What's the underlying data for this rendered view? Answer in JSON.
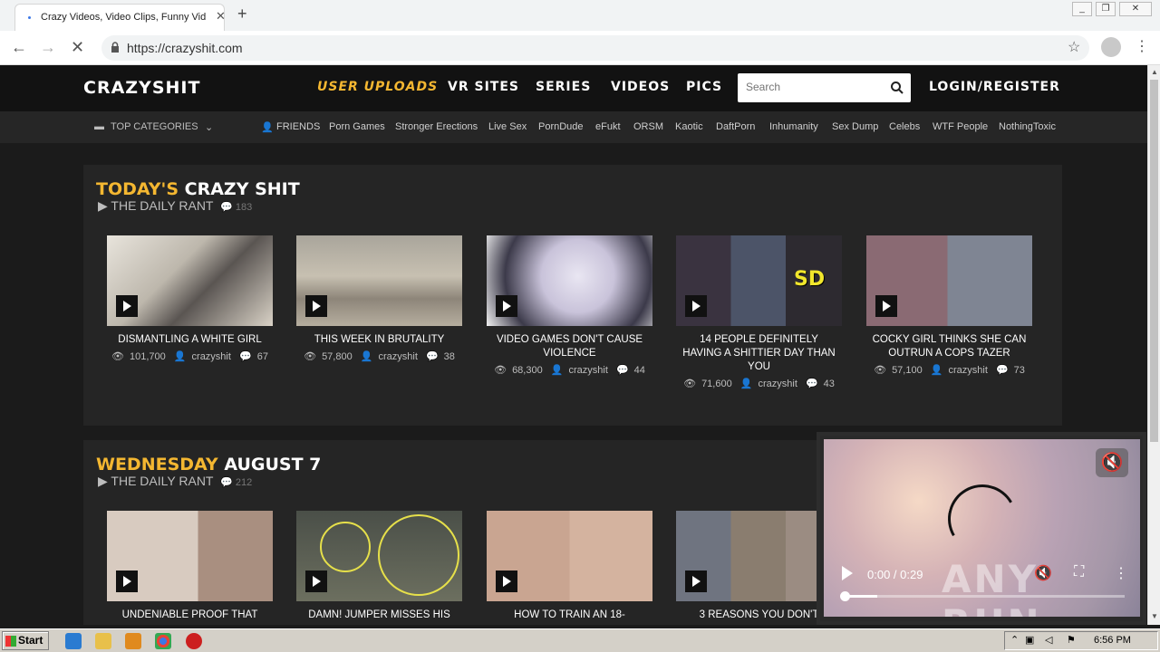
{
  "browser": {
    "tab_title": "Crazy Videos, Video Clips, Funny Vid",
    "tab_close": "✕",
    "new_tab": "+",
    "url": "https://crazyshit.com"
  },
  "site": {
    "logo": "CRAZYSHIT",
    "menu": [
      {
        "label": "USER UPLOADS"
      },
      {
        "label": "VR SITES"
      },
      {
        "label": "SERIES"
      },
      {
        "label": "VIDEOS"
      },
      {
        "label": "PICS"
      }
    ],
    "search_placeholder": "Search",
    "login": "LOGIN/REGISTER",
    "top_categories": "TOP CATEGORIES",
    "friends": "FRIENDS",
    "links": [
      "Porn Games",
      "Stronger Erections",
      "Live Sex",
      "PornDude",
      "eFukt",
      "ORSM",
      "Kaotic",
      "DaftPorn",
      "Inhumanity",
      "Sex Dump",
      "Celebs",
      "WTF People",
      "NothingToxic"
    ]
  },
  "sections": [
    {
      "title_hl": "TODAY'S",
      "title_rest": "CRAZY SHIT",
      "sub": "THE DAILY RANT",
      "sub_count": "183",
      "cards": [
        {
          "title": "DISMANTLING A WHITE GIRL",
          "views": "101,700",
          "user": "crazyshit",
          "comments": "67"
        },
        {
          "title": "THIS WEEK IN BRUTALITY",
          "views": "57,800",
          "user": "crazyshit",
          "comments": "38"
        },
        {
          "title": "VIDEO GAMES DON'T CAUSE VIOLENCE",
          "views": "68,300",
          "user": "crazyshit",
          "comments": "44"
        },
        {
          "title": "14 PEOPLE DEFINITELY HAVING A SHITTIER DAY THAN YOU",
          "views": "71,600",
          "user": "crazyshit",
          "comments": "43"
        },
        {
          "title": "COCKY GIRL THINKS SHE CAN OUTRUN A COPS TAZER",
          "views": "57,100",
          "user": "crazyshit",
          "comments": "73"
        }
      ]
    },
    {
      "title_hl": "WEDNESDAY",
      "title_rest": "AUGUST 7",
      "sub": "THE DAILY RANT",
      "sub_count": "212",
      "cards": [
        {
          "title": "UNDENIABLE PROOF THAT"
        },
        {
          "title": "DAMN! JUMPER MISSES HIS"
        },
        {
          "title": "HOW TO TRAIN AN 18-"
        },
        {
          "title": "3 REASONS YOU DON'T"
        }
      ]
    }
  ],
  "player": {
    "time": "0:00 / 0:29",
    "progress": 0.12,
    "watermark": "ANY RUN"
  },
  "taskbar": {
    "start": "Start",
    "clock": "6:56 PM"
  },
  "colors": {
    "accent": "#f4b731",
    "header_bg": "#121212",
    "section_bg": "#252525"
  }
}
